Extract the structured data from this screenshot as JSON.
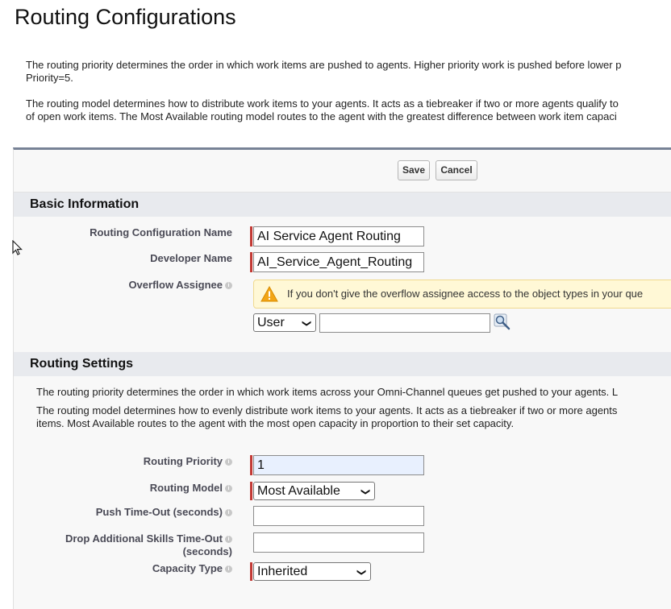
{
  "page": {
    "title": "Routing Configurations",
    "intro_1_line1": "The routing priority determines the order in which work items are pushed to agents. Higher priority work is pushed before lower p",
    "intro_1_line2": "Priority=5.",
    "intro_2_line1": "The routing model determines how to distribute work items to your agents. It acts as a tiebreaker if two or more agents qualify to",
    "intro_2_line2": "of open work items. The Most Available routing model routes to the agent with the greatest difference between work item capaci"
  },
  "buttons": {
    "save": "Save",
    "cancel": "Cancel"
  },
  "basic_info": {
    "heading": "Basic Information",
    "config_name": {
      "label": "Routing Configuration Name",
      "value": "AI Service Agent Routing"
    },
    "developer_name": {
      "label": "Developer Name",
      "value": "AI_Service_Agent_Routing"
    },
    "overflow": {
      "label": "Overflow Assignee",
      "warning": "If you don't give the overflow assignee access to the object types in your que",
      "type_select": "User",
      "value": ""
    }
  },
  "routing_settings": {
    "heading": "Routing Settings",
    "desc_1": "The routing priority determines the order in which work items across your Omni-Channel queues get pushed to your agents. L",
    "desc_2_line1": "The routing model determines how to evenly distribute work items to your agents. It acts as a tiebreaker if two or more agents",
    "desc_2_line2": "items. Most Available routes to the agent with the most open capacity in proportion to their set capacity.",
    "priority": {
      "label": "Routing Priority",
      "value": "1"
    },
    "model": {
      "label": "Routing Model",
      "value": "Most Available"
    },
    "push_timeout": {
      "label": "Push Time-Out (seconds)",
      "value": ""
    },
    "drop_skills": {
      "label_line1": "Drop Additional Skills Time-Out",
      "label_line2": "(seconds)",
      "value": ""
    },
    "capacity_type": {
      "label": "Capacity Type",
      "value": "Inherited"
    }
  },
  "colors": {
    "required_bar": "#c23934",
    "panel_border": "#778296",
    "section_bg": "#e8eaee",
    "warning_bg": "#fff8d6"
  }
}
